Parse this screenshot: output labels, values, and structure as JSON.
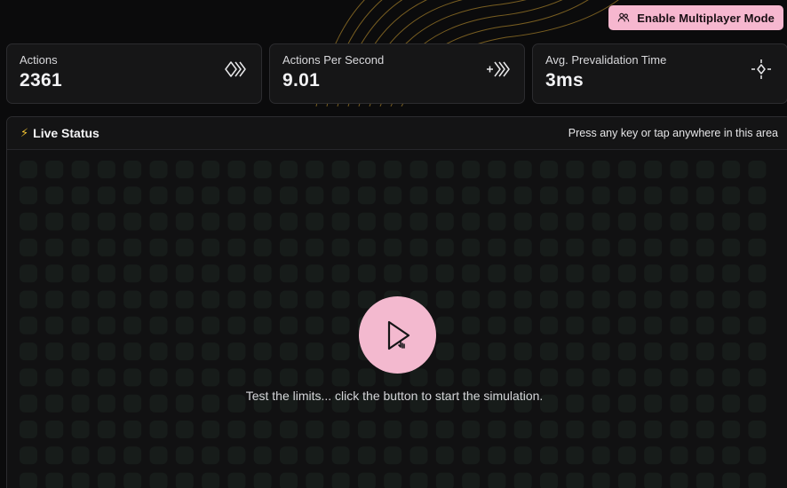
{
  "header": {
    "multiplayer_label": "Enable Multiplayer Mode"
  },
  "stats": [
    {
      "label": "Actions",
      "value": "2361",
      "icon": "double-chevron-icon"
    },
    {
      "label": "Actions Per Second",
      "value": "9.01",
      "icon": "plus-chevrons-icon"
    },
    {
      "label": "Avg. Prevalidation Time",
      "value": "3ms",
      "icon": "crosshair-diamond-icon"
    }
  ],
  "live": {
    "title": "Live Status",
    "hint": "Press any key or tap anywhere in this area",
    "message": "Test the limits... click the button to start the simulation."
  },
  "colors": {
    "accent_pink": "#f6b7cf",
    "bolt": "#f1c232",
    "background": "#0b0b0c",
    "contour": "#a8822a",
    "grid_dot": "#1e2a25"
  }
}
